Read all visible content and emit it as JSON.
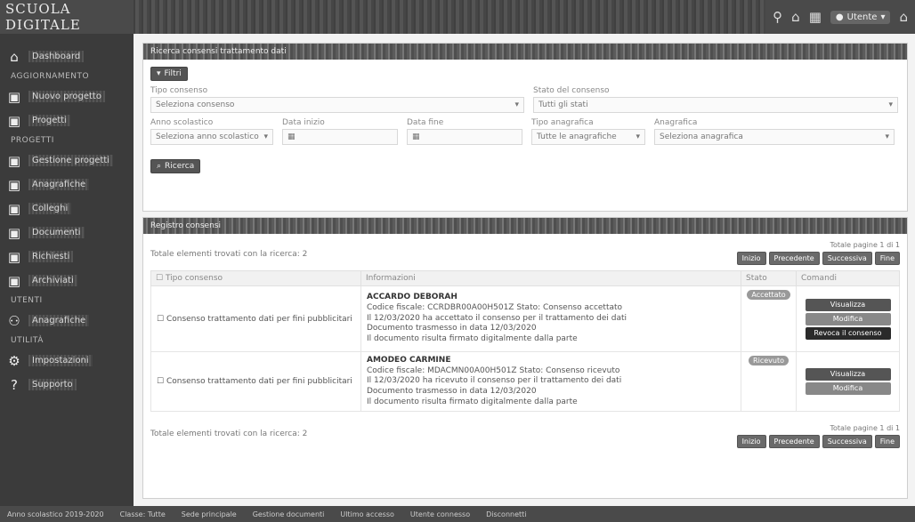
{
  "app": {
    "brand": "SCUOLA DIGITALE"
  },
  "topbar": {
    "icons": [
      "rocket-icon",
      "home-icon",
      "calendar-icon",
      "user-icon",
      "home-alt-icon"
    ],
    "user_label": "Utente"
  },
  "sidebar": {
    "items": [
      {
        "icon": "home-icon",
        "label": "Dashboard"
      },
      {
        "section": "AGGIORNAMENTO"
      },
      {
        "icon": "chat-icon",
        "label": "Nuovo progetto"
      },
      {
        "icon": "chat-icon",
        "label": "Progetti"
      },
      {
        "section": "PROGETTI"
      },
      {
        "icon": "chat-icon",
        "label": "Gestione progetti"
      },
      {
        "icon": "chat-icon",
        "label": "Anagrafiche"
      },
      {
        "icon": "chat-icon",
        "label": "Colleghi"
      },
      {
        "icon": "chat-icon",
        "label": "Documenti"
      },
      {
        "icon": "chat-icon",
        "label": "Richiesti"
      },
      {
        "icon": "chat-icon",
        "label": "Archiviati"
      },
      {
        "section": "UTENTI"
      },
      {
        "icon": "users-icon",
        "label": "Anagrafiche"
      },
      {
        "section": "UTILITÀ"
      },
      {
        "icon": "gear-icon",
        "label": "Impostazioni"
      },
      {
        "icon": "help-icon",
        "label": "Supporto"
      }
    ]
  },
  "filter_panel": {
    "title": "Ricerca consensi trattamento dati",
    "filter_button": "Filtri",
    "tipo_label": "Tipo consenso",
    "tipo_value": "Seleziona consenso",
    "stato_label": "Stato del consenso",
    "stato_value": "Tutti gli stati",
    "anno_label": "Anno scolastico",
    "anno_value": "Seleziona anno scolastico",
    "data_inizio_label": "Data inizio",
    "data_fine_label": "Data fine",
    "tipo_anag_label": "Tipo anagrafica",
    "tipo_anag_value": "Tutte le anagrafiche",
    "anag_label": "Anagrafica",
    "anag_value": "Seleziona anagrafica",
    "search_button": "Ricerca"
  },
  "results_panel": {
    "title": "Registro consensi",
    "total_text": "Totale elementi trovati con la ricerca: 2",
    "page_text": "Totale pagine 1 di 1",
    "pager": [
      "Inizio",
      "Precedente",
      "Successiva",
      "Fine"
    ],
    "columns": [
      "Tipo consenso",
      "Informazioni",
      "Stato",
      "Comandi"
    ],
    "rows": [
      {
        "tipo": "Consenso trattamento dati per fini pubblicitari",
        "name": "ACCARDO DEBORAH",
        "line1": "Codice fiscale: CCRDBR00A00H501Z Stato: Consenso accettato",
        "line2": "Il 12/03/2020 ha accettato il consenso per il trattamento dei dati",
        "line3": "Documento trasmesso in data 12/03/2020",
        "line4": "Il documento risulta firmato digitalmente dalla parte",
        "status": "Accettato",
        "actions": [
          "Visualizza",
          "Modifica",
          "Revoca il consenso"
        ]
      },
      {
        "tipo": "Consenso trattamento dati per fini pubblicitari",
        "name": "AMODEO CARMINE",
        "line1": "Codice fiscale: MDACMN00A00H501Z Stato: Consenso ricevuto",
        "line2": "Il 12/03/2020 ha ricevuto il consenso per il trattamento dei dati",
        "line3": "Documento trasmesso in data 12/03/2020",
        "line4": "Il documento risulta firmato digitalmente dalla parte",
        "status": "Ricevuto",
        "actions": [
          "Visualizza",
          "Modifica"
        ]
      }
    ],
    "footer_total": "Totale elementi trovati con la ricerca: 2"
  },
  "bottombar": {
    "items": [
      "Anno scolastico 2019-2020",
      "Classe: Tutte",
      "Sede principale",
      "Gestione documenti",
      "Ultimo accesso",
      "Utente connesso",
      "Disconnetti"
    ]
  }
}
